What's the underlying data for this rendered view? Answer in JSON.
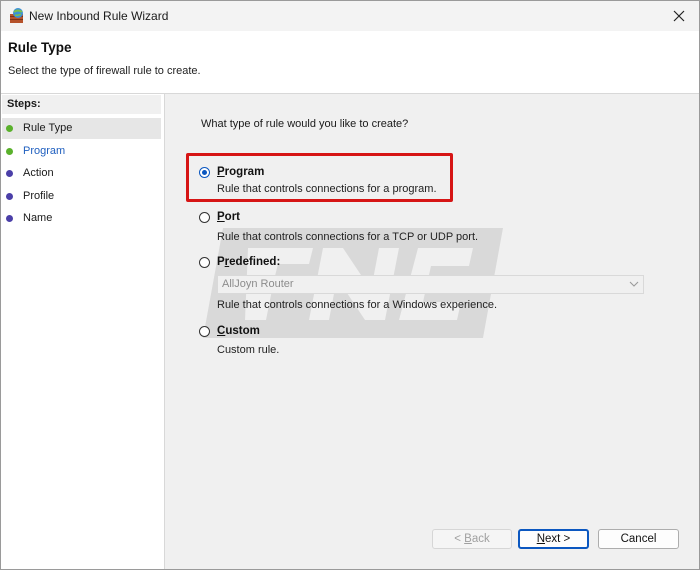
{
  "window": {
    "title": "New Inbound Rule Wizard",
    "app_icon": "firewall-wizard-icon",
    "close_icon": "close-icon"
  },
  "header": {
    "title": "Rule Type",
    "subtitle": "Select the type of firewall rule to create."
  },
  "steps": {
    "heading": "Steps:",
    "items": [
      {
        "label": "Rule Type",
        "state": "current",
        "color": "#5ab12c"
      },
      {
        "label": "Program",
        "state": "active",
        "color": "#5ab12c"
      },
      {
        "label": "Action",
        "state": "pending",
        "color": "#4b3fa8"
      },
      {
        "label": "Profile",
        "state": "pending",
        "color": "#4b3fa8"
      },
      {
        "label": "Name",
        "state": "pending",
        "color": "#4b3fa8"
      }
    ]
  },
  "main": {
    "question": "What type of rule would you like to create?",
    "options": {
      "program": {
        "title_accel": "P",
        "title_rest": "rogram",
        "desc": "Rule that controls connections for a program.",
        "selected": true
      },
      "port": {
        "title_accel": "P",
        "title_rest": "ort",
        "desc": "Rule that controls connections for a TCP or UDP port.",
        "selected": false
      },
      "predefined": {
        "title_pre": "P",
        "title_accel": "r",
        "title_rest": "edefined:",
        "desc": "Rule that controls connections for a Windows experience.",
        "selected": false,
        "combo_value": "AllJoyn Router"
      },
      "custom": {
        "title_accel": "C",
        "title_rest": "ustom",
        "desc": "Custom rule.",
        "selected": false
      }
    }
  },
  "buttons": {
    "back_accel": "B",
    "back_pre": "< ",
    "back_rest": "ack",
    "next_accel": "N",
    "next_rest": "ext >",
    "cancel": "Cancel"
  },
  "colors": {
    "highlight": "#d61515",
    "accent": "#0b57c0"
  }
}
